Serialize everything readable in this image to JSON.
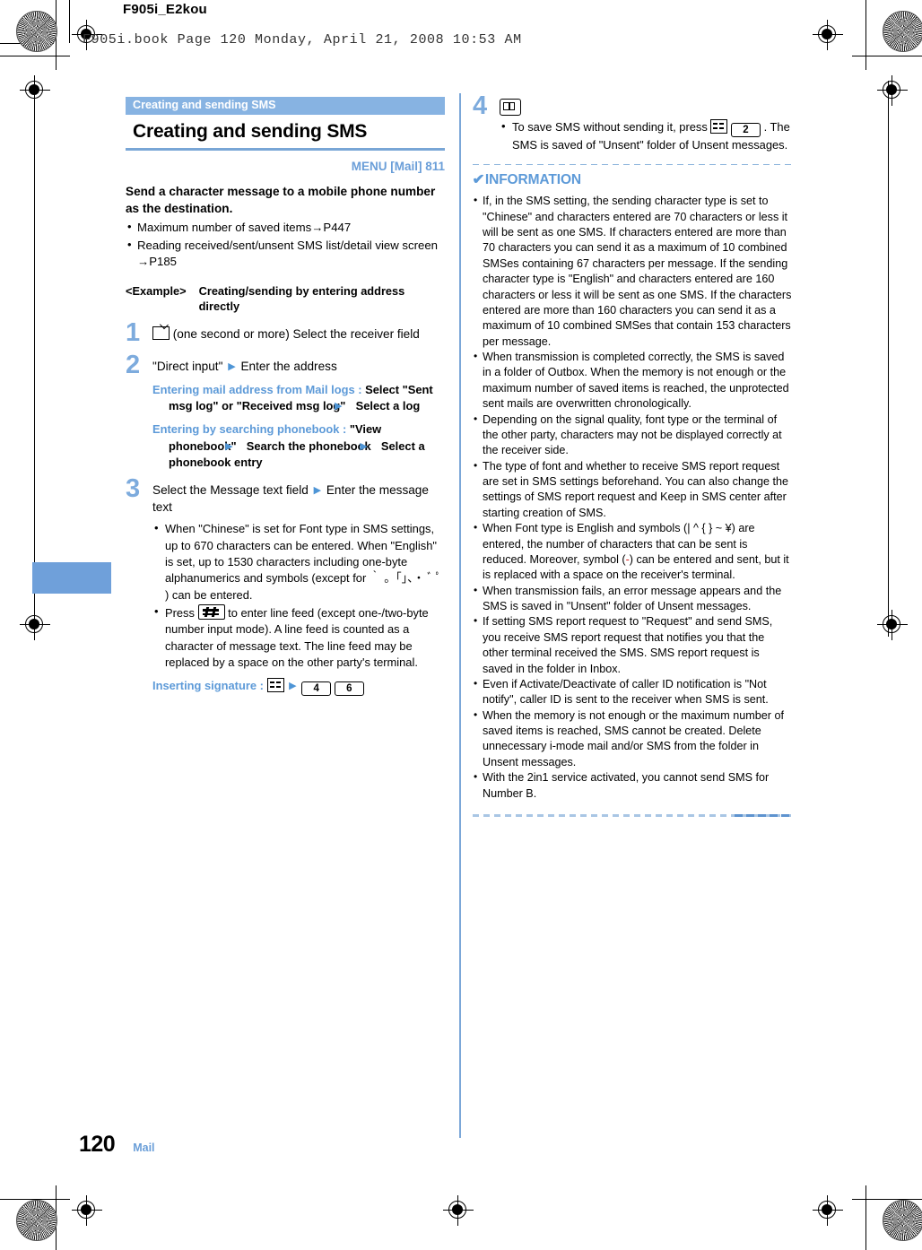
{
  "page": {
    "doc_code": "F905i_E2kou",
    "book_line": "F905i.book  Page 120  Monday, April 21, 2008  10:53 AM",
    "page_number": "120",
    "footer_label": "Mail",
    "accent_blue": "#6a9ed8",
    "bar_blue": "#87b3e2",
    "step_num_blue": "#7dabdd",
    "red": "#d4201e"
  },
  "heading": {
    "chapter": "Creating and sending SMS",
    "title": "Creating and sending SMS",
    "menu": "MENU [Mail] 811"
  },
  "intro": {
    "lead": "Send a character message to a mobile phone number as the destination.",
    "bullets": [
      "Maximum number of saved items→P447",
      "Reading received/sent/unsent SMS list/detail view screen →P185"
    ]
  },
  "example": {
    "label": "<Example>",
    "text": "Creating/sending by entering address directly"
  },
  "steps": [
    {
      "num": "1",
      "icon": "mail-key-icon",
      "text": "(one second or more) Select the receiver field"
    },
    {
      "num": "2",
      "text_before": "\"Direct input\"",
      "text_after": "Enter the address",
      "subs": [
        {
          "head": "Entering mail address from Mail logs :",
          "body_1": "Select \"Sent msg log\" or \"Received msg log\"",
          "body_2": "Select a log"
        },
        {
          "head": "Entering by searching phonebook :",
          "body_1": "\"View phonebook\"",
          "body_2": "Search the phonebook",
          "body_3": "Select a phonebook entry"
        }
      ]
    },
    {
      "num": "3",
      "text_before": "Select the Message text field",
      "text_after": "Enter the message text",
      "bullets": [
        "When \"Chinese\" is set for Font type in SMS settings, up to 670 characters can be entered. When \"English\" is set, up to 1530 characters including one-byte alphanumerics and symbols (except for ｀ 。「」、・ ﾞ ﾟ ) can be entered.",
        "Press KEY_HASH to enter line feed (except one-/two-byte number input mode). A line feed is counted as a character of message text. The line feed may be replaced by a space on the other party's terminal."
      ],
      "signature": {
        "head": "Inserting signature :",
        "keys": [
          "4",
          "6"
        ]
      }
    },
    {
      "num": "4",
      "icon": "book-key-icon",
      "bullets": [
        "To save SMS without sending it, press KEY_MENU KEY_2 . The SMS is saved of \"Unsent\" folder of Unsent messages."
      ]
    }
  ],
  "information": {
    "title": "INFORMATION",
    "check_glyph": "✔",
    "items": [
      "If, in the SMS setting, the sending character type is set to \"Chinese\" and characters entered are 70 characters or less it will be sent as one SMS. If characters entered are more than 70 characters you can send it as a maximum of 10 combined SMSes containing 67 characters per message. If the sending character type is \"English\" and characters entered are 160 characters or less it will be sent as one SMS. If the characters entered are more than 160 characters you can send it as a maximum of 10 combined SMSes that contain 153 characters per message.",
      "When transmission is completed correctly, the SMS is saved in a folder of Outbox. When the memory is not enough or the maximum number of saved items is reached, the unprotected sent mails are overwritten chronologically.",
      "Depending on the signal quality, font type or the terminal of the other party, characters may not be displayed correctly at the receiver side.",
      "The type of font and whether to receive SMS report request are set in SMS settings beforehand. You can also change the settings of SMS report request and Keep in SMS center after starting creation of SMS.",
      "SPECIAL_SYMBOL_ITEM",
      "When transmission fails, an error message appears and the SMS is saved in \"Unsent\" folder of Unsent messages.",
      "If setting SMS report request to \"Request\" and send SMS, you receive SMS report request that notifies you that the other terminal received the SMS. SMS report request is saved in the folder in Inbox.",
      "Even if Activate/Deactivate of caller ID notification is \"Not notify\", caller ID is sent to the receiver when SMS is sent.",
      "When the memory is not enough or the maximum number of saved items is reached, SMS cannot be created. Delete unnecessary i-mode mail and/or SMS from the folder in Unsent messages.",
      "With the 2in1 service activated, you cannot send SMS for Number B."
    ],
    "symbol_item": {
      "part1": "When Font type is English and symbols (| ^ { } ~ ¥) are entered, the number of characters that can be sent is reduced. Moreover, symbol (",
      "symbol": "-",
      "part2": ") can be entered and sent, but it is replaced with a space on the receiver's terminal."
    }
  }
}
